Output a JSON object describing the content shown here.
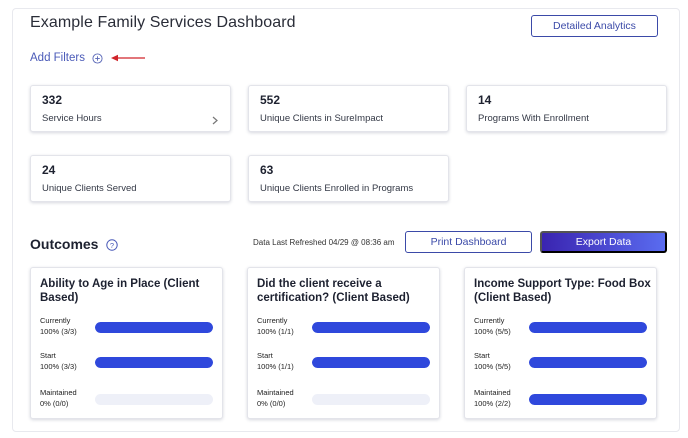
{
  "header": {
    "title": "Example Family Services Dashboard",
    "analytics_label": "Detailed Analytics"
  },
  "filters": {
    "label": "Add Filters"
  },
  "stats": [
    {
      "value": "332",
      "label": "Service Hours"
    },
    {
      "value": "552",
      "label": "Unique Clients in SureImpact"
    },
    {
      "value": "14",
      "label": "Programs With Enrollment"
    },
    {
      "value": "24",
      "label": "Unique Clients Served"
    },
    {
      "value": "63",
      "label": "Unique Clients Enrolled in Programs"
    }
  ],
  "outcomes": {
    "title": "Outcomes",
    "refreshed": "Data Last Refreshed 04/29 @ 08:36 am",
    "print_label": "Print Dashboard",
    "export_label": "Export Data",
    "cards": [
      {
        "title": "Ability to Age in Place (Client Based)",
        "metrics": [
          {
            "label": "Currently",
            "value": "100% (3/3)",
            "pct": 100
          },
          {
            "label": "Start",
            "value": "100% (3/3)",
            "pct": 100
          },
          {
            "label": "Maintained",
            "value": "0% (0/0)",
            "pct": 0
          }
        ]
      },
      {
        "title": "Did the client receive a certification? (Client Based)",
        "metrics": [
          {
            "label": "Currently",
            "value": "100% (1/1)",
            "pct": 100
          },
          {
            "label": "Start",
            "value": "100% (1/1)",
            "pct": 100
          },
          {
            "label": "Maintained",
            "value": "0% (0/0)",
            "pct": 0
          }
        ]
      },
      {
        "title": "Income Support Type: Food Box (Client Based)",
        "metrics": [
          {
            "label": "Currently",
            "value": "100% (5/5)",
            "pct": 100
          },
          {
            "label": "Start",
            "value": "100% (5/5)",
            "pct": 100
          },
          {
            "label": "Maintained",
            "value": "100% (2/2)",
            "pct": 100
          }
        ]
      }
    ]
  },
  "colors": {
    "accent": "#3b4aa8",
    "bar_fill": "#2f48dc",
    "bar_track": "#eef0f8",
    "annotation_arrow": "#d0242a"
  },
  "icons": {
    "filters": "plus-circle-icon",
    "help": "question-circle-icon",
    "stat_link": "chevron-right-icon"
  }
}
